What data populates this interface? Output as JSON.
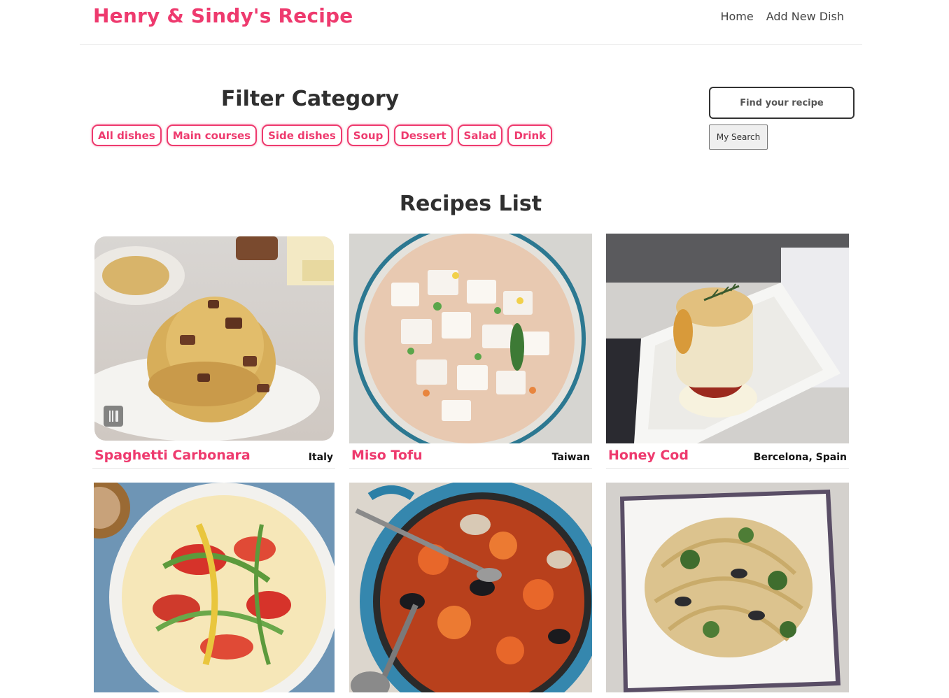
{
  "brand": "Henry & Sindy's Recipe",
  "nav": {
    "home": "Home",
    "add": "Add New Dish"
  },
  "filter": {
    "title": "Filter Category",
    "chips": [
      "All dishes",
      "Main courses",
      "Side dishes",
      "Soup",
      "Dessert",
      "Salad",
      "Drink"
    ]
  },
  "search": {
    "placeholder": "Find your recipe",
    "button": "My Search"
  },
  "recipes_title": "Recipes List",
  "recipes": [
    {
      "name": "Spaghetti Carbonara",
      "place": "Italy"
    },
    {
      "name": "Miso Tofu",
      "place": "Taiwan"
    },
    {
      "name": "Honey Cod",
      "place": "Bercelona, Spain"
    },
    {
      "name": "",
      "place": ""
    },
    {
      "name": "",
      "place": ""
    },
    {
      "name": "",
      "place": ""
    }
  ],
  "colors": {
    "accent": "#ee3a6e",
    "heading": "#2f2f2f"
  },
  "icons": {
    "image_action": "utensils-icon"
  }
}
